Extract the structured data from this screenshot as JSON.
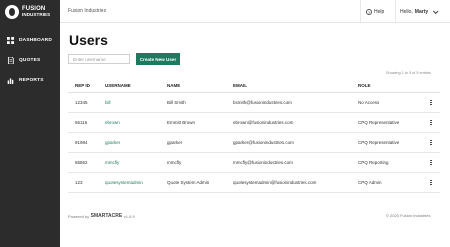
{
  "app": {
    "logo_line1": "FUSION",
    "logo_line2": "INDUSTRIES"
  },
  "sidebar": {
    "items": [
      {
        "label": "DASHBOARD",
        "icon": "grid-icon"
      },
      {
        "label": "QUOTES",
        "icon": "document-icon"
      },
      {
        "label": "REPORTS",
        "icon": "bar-chart-icon"
      }
    ]
  },
  "header": {
    "company": "Fusion Industries",
    "help_label": "Help",
    "greeting": "Hello,",
    "user_name": "Marty"
  },
  "main": {
    "title": "Users",
    "search_placeholder": "Enter username",
    "create_button": "Create New User",
    "showing_text": "Showing 1 to 5 of 5 entries"
  },
  "table": {
    "headers": {
      "rep_id": "REP ID",
      "username": "USERNAME",
      "name": "NAME",
      "email": "EMAIL",
      "role": "ROLE"
    },
    "rows": [
      {
        "rep_id": "12345",
        "username": "bill",
        "name": "Bill Smith",
        "email": "bsmith@fusionindustries.com",
        "role": "No Access"
      },
      {
        "rep_id": "56116",
        "username": "ebrown",
        "name": "Emmitt Brown",
        "email": "ebrown@fusionindustries.com",
        "role": "CPQ Representative"
      },
      {
        "rep_id": "91984",
        "username": "gparker",
        "name": "gparker",
        "email": "gparker@fusionindustries.com",
        "role": "CPQ Representative"
      },
      {
        "rep_id": "85862",
        "username": "mmcfly",
        "name": "mmcfly",
        "email": "mmcfly@fusionindustries.com",
        "role": "CPQ Reporting"
      },
      {
        "rep_id": "123",
        "username": "quotesystemadmin",
        "name": "Quote System Admin",
        "email": "quotesystemadmin@fusionindustries.com",
        "role": "CPQ Admin"
      }
    ]
  },
  "footer": {
    "powered_by": "Powered by",
    "brand": "SMARTACRE",
    "version": "v1.0.9",
    "copyright": "© 2020 Fusion Industries"
  },
  "colors": {
    "sidebar_bg": "#2c2c2c",
    "accent": "#1e7a5f"
  }
}
